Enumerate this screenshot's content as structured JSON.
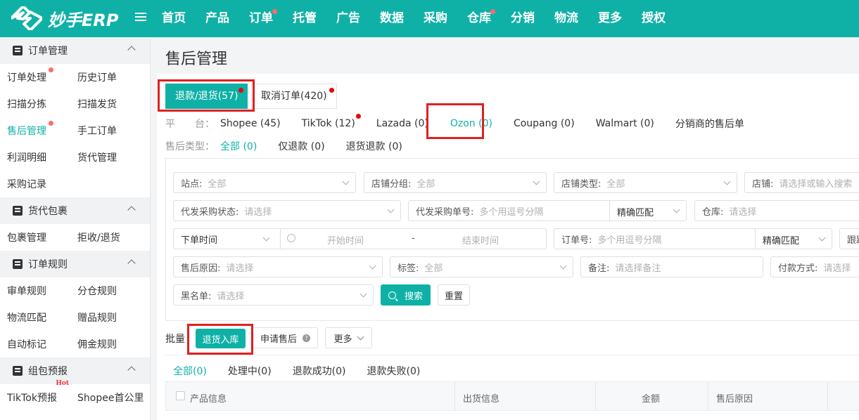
{
  "app": {
    "name": "妙手ERP"
  },
  "nav": [
    {
      "label": "首页",
      "dot": false
    },
    {
      "label": "产品",
      "dot": false
    },
    {
      "label": "订单",
      "dot": true
    },
    {
      "label": "托管",
      "dot": false
    },
    {
      "label": "广告",
      "dot": false
    },
    {
      "label": "数据",
      "dot": false
    },
    {
      "label": "采购",
      "dot": false
    },
    {
      "label": "仓库",
      "dot": true
    },
    {
      "label": "分销",
      "dot": false
    },
    {
      "label": "物流",
      "dot": false
    },
    {
      "label": "更多",
      "dot": false
    },
    {
      "label": "授权",
      "dot": false
    }
  ],
  "sidebar": {
    "groups": [
      {
        "title": "订单管理",
        "items": [
          "订单处理",
          "历史订单",
          "扫描分拣",
          "扫描发货",
          "售后管理",
          "手工订单",
          "利润明细",
          "货代管理",
          "采购记录"
        ]
      },
      {
        "title": "货代包裹",
        "items": [
          "包裹管理",
          "拒收/退货"
        ]
      },
      {
        "title": "订单规则",
        "items": [
          "审单规则",
          "分仓规则",
          "物流匹配",
          "赠品规则",
          "自动标记",
          "佣金规则"
        ]
      },
      {
        "title": "组包预报",
        "items": [
          "TikTok预报",
          "Shopee首公里"
        ]
      }
    ],
    "hot_badge": "Hot"
  },
  "page": {
    "title": "售后管理"
  },
  "status_tabs": [
    {
      "label": "退款/退货(57)",
      "active": true
    },
    {
      "label": "取消订单(420)",
      "active": false
    }
  ],
  "platform": {
    "label": "平　　台：",
    "options": [
      "Shopee (45)",
      "TikTok (12)",
      "Lazada (0)",
      "Ozon (0)",
      "Coupang (0)",
      "Walmart (0)",
      "分销商的售后单"
    ]
  },
  "aftersale_type": {
    "label": "售后类型：",
    "options": [
      "全部 (0)",
      "仅退款 (0)",
      "退货退款 (0)"
    ]
  },
  "filters": {
    "site": {
      "label": "站点:",
      "value": "全部"
    },
    "shop_group": {
      "label": "店铺分组:",
      "value": "全部"
    },
    "shop_type": {
      "label": "店铺类型:",
      "value": "全部"
    },
    "shop": {
      "label": "店铺:",
      "placeholder": "请选择或输入搜索"
    },
    "purchase_status": {
      "label": "代发采购状态:",
      "placeholder": "请选择"
    },
    "purchase_no": {
      "label": "代发采购单号:",
      "placeholder": "多个用逗号分隔"
    },
    "exact_match_1": "精确匹配",
    "warehouse": {
      "label": "仓库:",
      "placeholder": "请选择"
    },
    "time_type": "下单时间",
    "start_time": "开始时间",
    "time_sep": "-",
    "end_time": "结束时间",
    "order_no": {
      "label": "订单号:",
      "placeholder": "多个用逗号分隔"
    },
    "exact_match_2": "精确匹配",
    "tracking_cut": "跟踪",
    "reason": {
      "label": "售后原因:",
      "placeholder": "请选择"
    },
    "tag": {
      "label": "标签:",
      "value": "全部"
    },
    "remark": {
      "label": "备注:",
      "placeholder": "请选择备注"
    },
    "payment": {
      "label": "付款方式:",
      "placeholder": "请选择"
    },
    "blacklist": {
      "label": "黑名单:",
      "placeholder": "请选择"
    },
    "search_btn": "搜索",
    "reset_btn": "重置"
  },
  "batch": {
    "label": "批量",
    "return_stock": "退货入库",
    "apply_aftersale": "申请售后",
    "help_icon": "?",
    "more": "更多"
  },
  "result_tabs": [
    {
      "label": "全部(0)",
      "active": true
    },
    {
      "label": "处理中(0)",
      "active": false
    },
    {
      "label": "退款成功(0)",
      "active": false
    },
    {
      "label": "退款失败(0)",
      "active": false
    }
  ],
  "table": {
    "columns": [
      "产品信息",
      "出货信息",
      "金额",
      "售后原因"
    ]
  },
  "colors": {
    "brand": "#0fb1a7",
    "highlight_box": "#e02020",
    "dot": "#e00000"
  }
}
